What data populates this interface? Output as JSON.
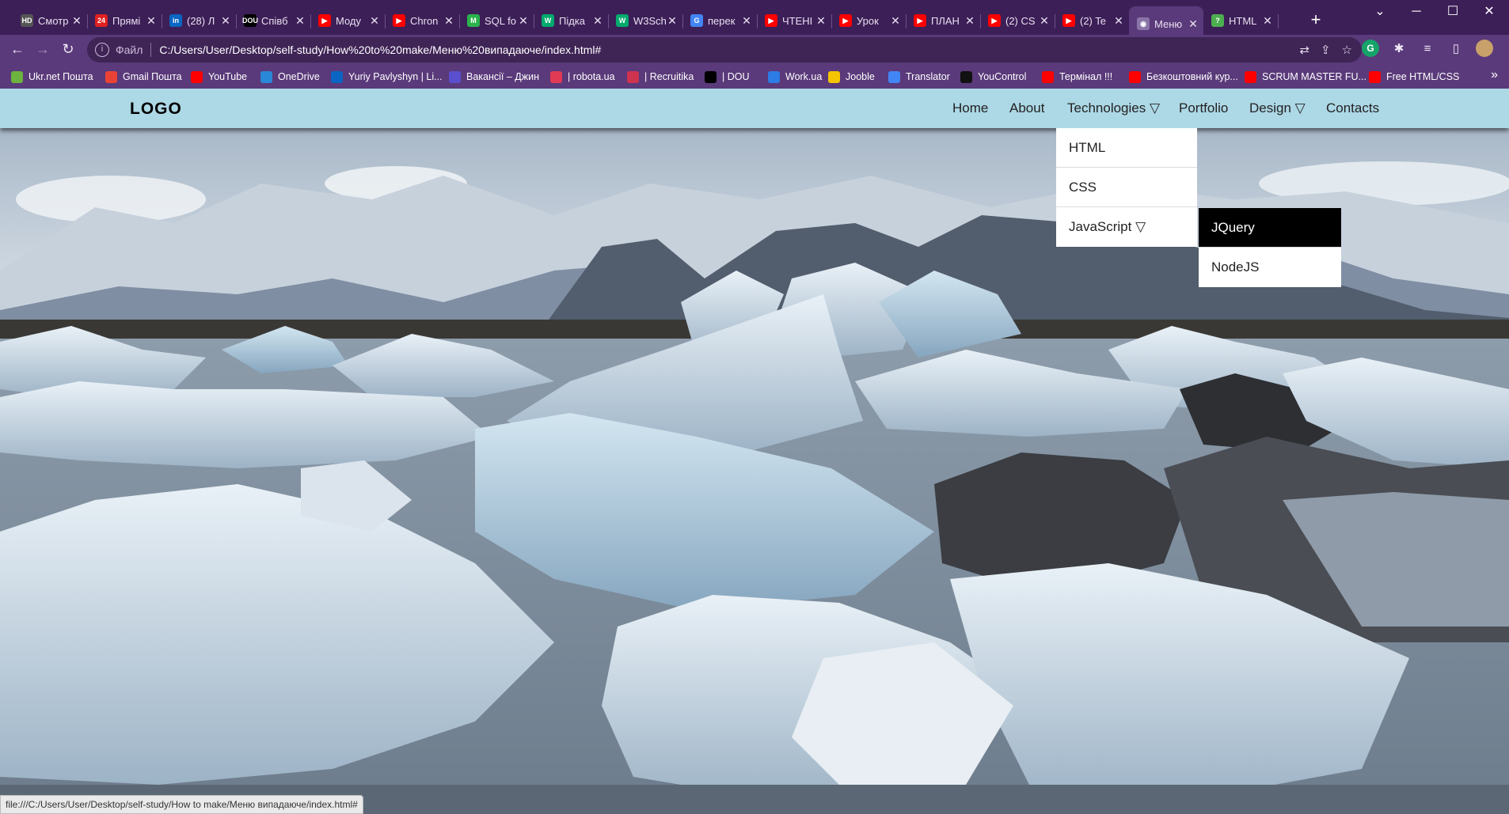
{
  "tabs": [
    {
      "title": "Смотр",
      "icon": "hd-icon",
      "color": "#555555",
      "glyph": "HD"
    },
    {
      "title": "Прямі",
      "icon": "24-icon",
      "color": "#e02020",
      "glyph": "24"
    },
    {
      "title": "(28) Л",
      "icon": "linkedin-icon",
      "color": "#0a66c2",
      "glyph": "in"
    },
    {
      "title": "Співб",
      "icon": "dou-icon",
      "color": "#000000",
      "glyph": "DOU"
    },
    {
      "title": "Моду",
      "icon": "youtube-icon",
      "color": "#ff0000",
      "glyph": "▶"
    },
    {
      "title": "Chron",
      "icon": "youtube-icon",
      "color": "#ff0000",
      "glyph": "▶"
    },
    {
      "title": "SQL fo",
      "icon": "mongo-icon",
      "color": "#2bb24c",
      "glyph": "M"
    },
    {
      "title": "Підка",
      "icon": "w3-icon",
      "color": "#04aa6d",
      "glyph": "W"
    },
    {
      "title": "W3Sch",
      "icon": "w3-icon",
      "color": "#04aa6d",
      "glyph": "W"
    },
    {
      "title": "перек",
      "icon": "google-icon",
      "color": "#4285f4",
      "glyph": "G"
    },
    {
      "title": "ЧТЕНІ",
      "icon": "youtube-icon",
      "color": "#ff0000",
      "glyph": "▶"
    },
    {
      "title": "Урок",
      "icon": "youtube-icon",
      "color": "#ff0000",
      "glyph": "▶"
    },
    {
      "title": "ПЛАН",
      "icon": "youtube-icon",
      "color": "#ff0000",
      "glyph": "▶"
    },
    {
      "title": "(2) CS",
      "icon": "youtube-icon",
      "color": "#ff0000",
      "glyph": "▶"
    },
    {
      "title": "(2) Te",
      "icon": "youtube-icon",
      "color": "#ff0000",
      "glyph": "▶"
    },
    {
      "title": "Меню",
      "icon": "globe-icon",
      "color": "#8a74a8",
      "glyph": "◉",
      "active": true
    },
    {
      "title": "HTML",
      "icon": "help-icon",
      "color": "#4caf50",
      "glyph": "?"
    }
  ],
  "toolbar": {
    "scheme": "Файл",
    "url": "C:/Users/User/Desktop/self-study/How%20to%20make/Меню%20випадаюче/index.html#"
  },
  "bookmarks": [
    {
      "label": "Ukr.net Пошта",
      "icon": "ukrnet-icon",
      "color": "#6cb33f"
    },
    {
      "label": "Gmail Пошта",
      "icon": "gmail-icon",
      "color": "#ea4335"
    },
    {
      "label": "YouTube",
      "icon": "youtube-icon",
      "color": "#ff0000"
    },
    {
      "label": "OneDrive",
      "icon": "onedrive-icon",
      "color": "#2b88d8"
    },
    {
      "label": "Yuriy Pavlyshyn | Li...",
      "icon": "linkedin-icon",
      "color": "#0a66c2"
    },
    {
      "label": "Вакансії – Джин",
      "icon": "djinni-icon",
      "color": "#5a4fcf"
    },
    {
      "label": "| robota.ua",
      "icon": "robota-icon",
      "color": "#e23a55"
    },
    {
      "label": "| Recruitika",
      "icon": "recruitika-icon",
      "color": "#d0334f"
    },
    {
      "label": "| DOU",
      "icon": "dou-icon",
      "color": "#000000"
    },
    {
      "label": "Work.ua",
      "icon": "workua-icon",
      "color": "#2d7be5"
    },
    {
      "label": "Jooble",
      "icon": "jooble-icon",
      "color": "#f5c400"
    },
    {
      "label": "Translator",
      "icon": "google-icon",
      "color": "#4285f4"
    },
    {
      "label": "YouControl",
      "icon": "youcontrol-icon",
      "color": "#111111"
    },
    {
      "label": "Термінал !!!",
      "icon": "youtube-icon",
      "color": "#ff0000"
    },
    {
      "label": "Безкоштовний кур...",
      "icon": "youtube-icon",
      "color": "#ff0000"
    },
    {
      "label": "SCRUM MASTER FU...",
      "icon": "youtube-icon",
      "color": "#ff0000"
    },
    {
      "label": "Free HTML/CSS",
      "icon": "youtube-icon",
      "color": "#ff0000"
    }
  ],
  "site": {
    "logo": "LOGO",
    "menu": [
      {
        "label": "Home"
      },
      {
        "label": "About"
      },
      {
        "label": "Technologies ▽"
      },
      {
        "label": "Portfolio"
      },
      {
        "label": "Design ▽"
      },
      {
        "label": "Contacts"
      }
    ],
    "technologies_dropdown": [
      "HTML",
      "CSS",
      "JavaScript ▽"
    ],
    "javascript_submenu": [
      "JQuery",
      "NodeJS"
    ]
  },
  "status_bar": "file:///C:/Users/User/Desktop/self-study/How to make/Меню випадаюче/index.html#"
}
